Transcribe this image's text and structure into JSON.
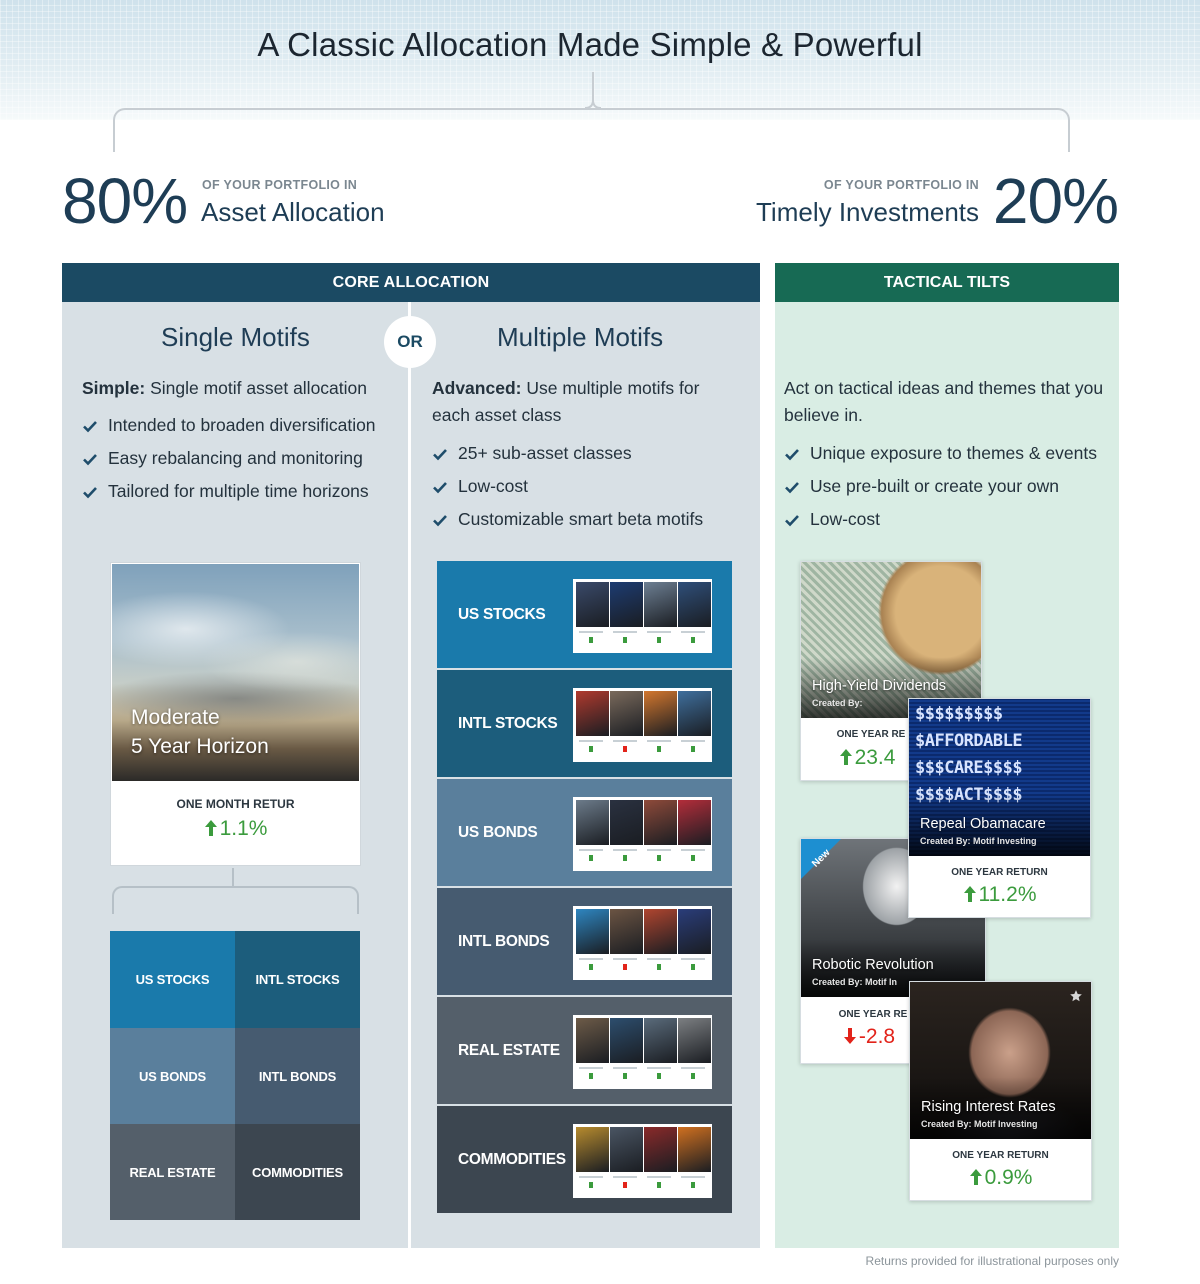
{
  "header": {
    "title": "A Classic Allocation Made Simple & Powerful"
  },
  "split": {
    "left": {
      "percent": "80%",
      "caption": "OF YOUR PORTFOLIO IN",
      "name": "Asset Allocation",
      "value": 80
    },
    "right": {
      "percent": "20%",
      "caption": "OF YOUR PORTFOLIO IN",
      "name": "Timely Investments",
      "value": 20
    }
  },
  "core": {
    "header": "CORE ALLOCATION",
    "or_label": "OR",
    "single": {
      "title": "Single Motifs",
      "intro_bold": "Simple:",
      "intro_text": " Single motif asset allocation",
      "bullets": [
        "Intended to broaden diversification",
        "Easy rebalancing and monitoring",
        "Tailored for multiple time horizons"
      ],
      "card": {
        "line1": "Moderate",
        "line2": "5 Year Horizon",
        "return_label": "ONE MONTH RETUR",
        "return_value": "1.1%",
        "return_direction": "up"
      },
      "grid": [
        {
          "label": "US STOCKS",
          "color": "#1a7aab"
        },
        {
          "label": "INTL STOCKS",
          "color": "#1c5d7c"
        },
        {
          "label": "US BONDS",
          "color": "#5a7f9c"
        },
        {
          "label": "INTL BONDS",
          "color": "#465b70"
        },
        {
          "label": "REAL ESTATE",
          "color": "#545f6a"
        },
        {
          "label": "COMMODITIES",
          "color": "#3c4650"
        }
      ]
    },
    "multiple": {
      "title": "Multiple Motifs",
      "intro_bold": "Advanced:",
      "intro_text": " Use multiple motifs for each asset class",
      "bullets": [
        "25+ sub-asset classes",
        "Low-cost",
        "Customizable smart beta motifs"
      ],
      "rows": [
        {
          "label": "US STOCKS",
          "color": "#1a7aab"
        },
        {
          "label": "INTL STOCKS",
          "color": "#1c5d7c"
        },
        {
          "label": "US BONDS",
          "color": "#5a7f9c"
        },
        {
          "label": "INTL BONDS",
          "color": "#465b70"
        },
        {
          "label": "REAL ESTATE",
          "color": "#545f6a"
        },
        {
          "label": "COMMODITIES",
          "color": "#3c4650"
        }
      ]
    }
  },
  "tactical": {
    "header": "TACTICAL TILTS",
    "intro": "Act on tactical ideas and themes that you believe in.",
    "bullets": [
      "Unique exposure to themes & events",
      "Use pre-built or create your own",
      "Low-cost"
    ],
    "cards": [
      {
        "title": "High-Yield Dividends",
        "by": "Created By:",
        "return_label": "ONE YEAR RE",
        "return_value": "23.4",
        "direction": "up"
      },
      {
        "title": "Repeal Obamacare",
        "by": "Created By:",
        "by_name": "Motif Investing",
        "return_label": "ONE YEAR RETURN",
        "return_value": "11.2%",
        "direction": "up",
        "photo_text": [
          "$$$$$$$$$",
          "$AFFORDABLE",
          "$$$CARE$$$$",
          "$$$$ACT$$$$"
        ]
      },
      {
        "title": "Robotic Revolution",
        "by": "Created By:",
        "by_name": "Motif In",
        "return_label": "ONE YEAR RE",
        "return_value": "-2.8",
        "direction": "down",
        "badge": "New"
      },
      {
        "title": "Rising Interest Rates",
        "by": "Created By:",
        "by_name": "Motif Investing",
        "return_label": "ONE YEAR RETURN",
        "return_value": "0.9%",
        "direction": "up"
      }
    ]
  },
  "footnote": "Returns provided for illustrational purposes only",
  "icons": {
    "check": "check-icon",
    "up": "arrow-up-icon",
    "down": "arrow-down-icon",
    "star": "star-icon"
  },
  "colors": {
    "navy": "#1b4a63",
    "green": "#176a54",
    "up": "#3b9b3d",
    "down": "#e2231a"
  }
}
